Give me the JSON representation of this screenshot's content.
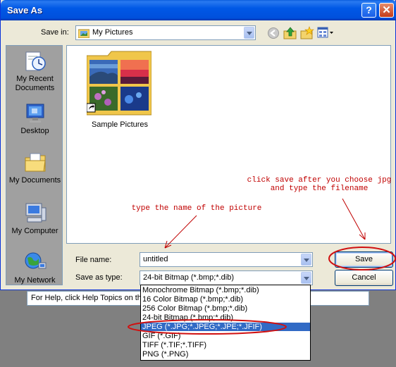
{
  "window": {
    "title": "Save As",
    "help_button": "?",
    "close_button": "✕"
  },
  "save_in": {
    "label": "Save in:",
    "value": "My Pictures"
  },
  "toolbar": {
    "back_icon": "back-icon",
    "up_icon": "up-folder-icon",
    "new_folder_icon": "new-folder-icon",
    "views_icon": "views-menu-icon"
  },
  "places": [
    {
      "label": "My Recent Documents",
      "icon": "recent-documents-icon"
    },
    {
      "label": "Desktop",
      "icon": "desktop-icon"
    },
    {
      "label": "My Documents",
      "icon": "my-documents-icon"
    },
    {
      "label": "My Computer",
      "icon": "my-computer-icon"
    },
    {
      "label": "My Network",
      "icon": "my-network-icon"
    }
  ],
  "files": [
    {
      "name": "Sample Pictures",
      "icon": "folder-shortcut-icon"
    }
  ],
  "file_name": {
    "label": "File name:",
    "value": "untitled"
  },
  "save_as_type": {
    "label": "Save as type:",
    "value": "24-bit Bitmap (*.bmp;*.dib)",
    "options": [
      "Monochrome Bitmap (*.bmp;*.dib)",
      "16 Color Bitmap (*.bmp;*.dib)",
      "256 Color Bitmap (*.bmp;*.dib)",
      "24-bit Bitmap (*.bmp;*.dib)",
      "JPEG (*.JPG;*.JPEG;*.JPE;*.JFIF)",
      "GIF (*.GIF)",
      "TIFF (*.TIF;*.TIFF)",
      "PNG (*.PNG)"
    ],
    "highlighted_index": 4
  },
  "buttons": {
    "save": "Save",
    "cancel": "Cancel"
  },
  "status_bar": "For Help, click Help Topics on the",
  "annotations": {
    "save_hint_line1": "click save after you choose jpg",
    "save_hint_line2": "and type the filename",
    "name_hint": "type the name of the picture",
    "color": "#c00000"
  }
}
